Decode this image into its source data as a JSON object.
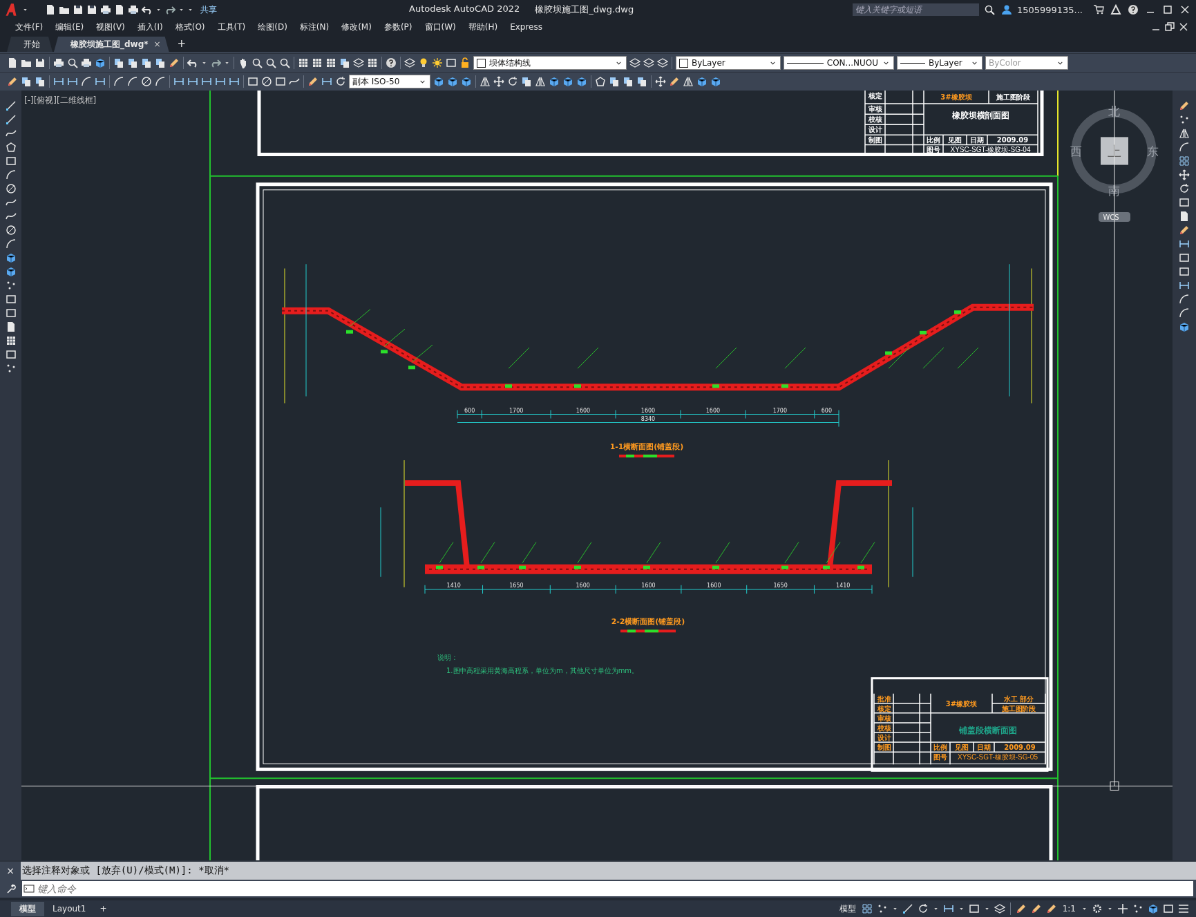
{
  "title_bar": {
    "app_title": "Autodesk AutoCAD 2022",
    "file_name": "橡胶坝施工图_dwg.dwg",
    "share": "共享",
    "search": {
      "placeholder": "键入关键字或短语"
    },
    "user": "1505999135..."
  },
  "menu": [
    "文件(F)",
    "编辑(E)",
    "视图(V)",
    "插入(I)",
    "格式(O)",
    "工具(T)",
    "绘图(D)",
    "标注(N)",
    "修改(M)",
    "参数(P)",
    "窗口(W)",
    "帮助(H)",
    "Express"
  ],
  "tabs": [
    {
      "label": "开始",
      "selected": false
    },
    {
      "label": "橡胶坝施工图_dwg*",
      "selected": true,
      "close": "×"
    }
  ],
  "new_tab": "+",
  "properties": {
    "layer": "坝体结构线",
    "color_setting": "ByLayer",
    "linetype": "CON...NUOU",
    "lineweight": "ByLayer",
    "plot_style": {
      "text": "ByColor",
      "disabled": true
    },
    "dim_style": "副本 ISO-50"
  },
  "viewport_label": "[-][俯视][二维线框]",
  "viewcube": {
    "north": "北",
    "south": "南",
    "east": "东",
    "west": "西",
    "top": "上",
    "ucs": "WCS"
  },
  "drawing": {
    "top_title_block": {
      "labels": [
        "核定",
        "审核",
        "校核",
        "设计",
        "制图"
      ],
      "project": "3#橡胶坝",
      "stage": "施工图阶段",
      "title": "橡胶坝横剖面图",
      "scale_label": "比例",
      "scale_value": "见图",
      "date_label": "日期",
      "date": "2009.09",
      "number_label": "图号",
      "number": "XYSC-SGT-橡胶坝-SG-04"
    },
    "section_1": {
      "title": "1-1横断面图(铺盖段)",
      "dims": [
        "600",
        "1700",
        "1600",
        "1600",
        "1600",
        "1700",
        "600"
      ],
      "total": "8340"
    },
    "section_2": {
      "title": "2-2横断面图(铺盖段)",
      "dims": [
        "1410",
        "1650",
        "1600",
        "1600",
        "1600",
        "1650",
        "1410"
      ]
    },
    "notes": {
      "heading": "说明：",
      "lines": [
        "1.图中高程采用黄海高程系，单位为m，其他尺寸单位为mm。"
      ]
    },
    "main_title_block": {
      "labels": [
        "批准",
        "核定",
        "审核",
        "校核",
        "设计",
        "制图"
      ],
      "project": "3#橡胶坝",
      "part": "水工 部分",
      "stage": "施工图阶段",
      "title": "铺盖段横断面图",
      "scale_label": "比例",
      "scale_value": "见图",
      "date_label": "日期",
      "date": "2009.09",
      "number_label": "图号",
      "number": "XYSC-SGT-橡胶坝-SG-05"
    }
  },
  "command": {
    "close": "×",
    "history": "选择注释对象或 [放弃(U)/模式(M)]: *取消*",
    "placeholder": "键入命令"
  },
  "layout_tabs": [
    {
      "label": "模型",
      "selected": true
    },
    {
      "label": "Layout1",
      "selected": false
    }
  ],
  "add_layout": "+",
  "status_bar": {
    "model": "模型",
    "scale": "1:1"
  }
}
